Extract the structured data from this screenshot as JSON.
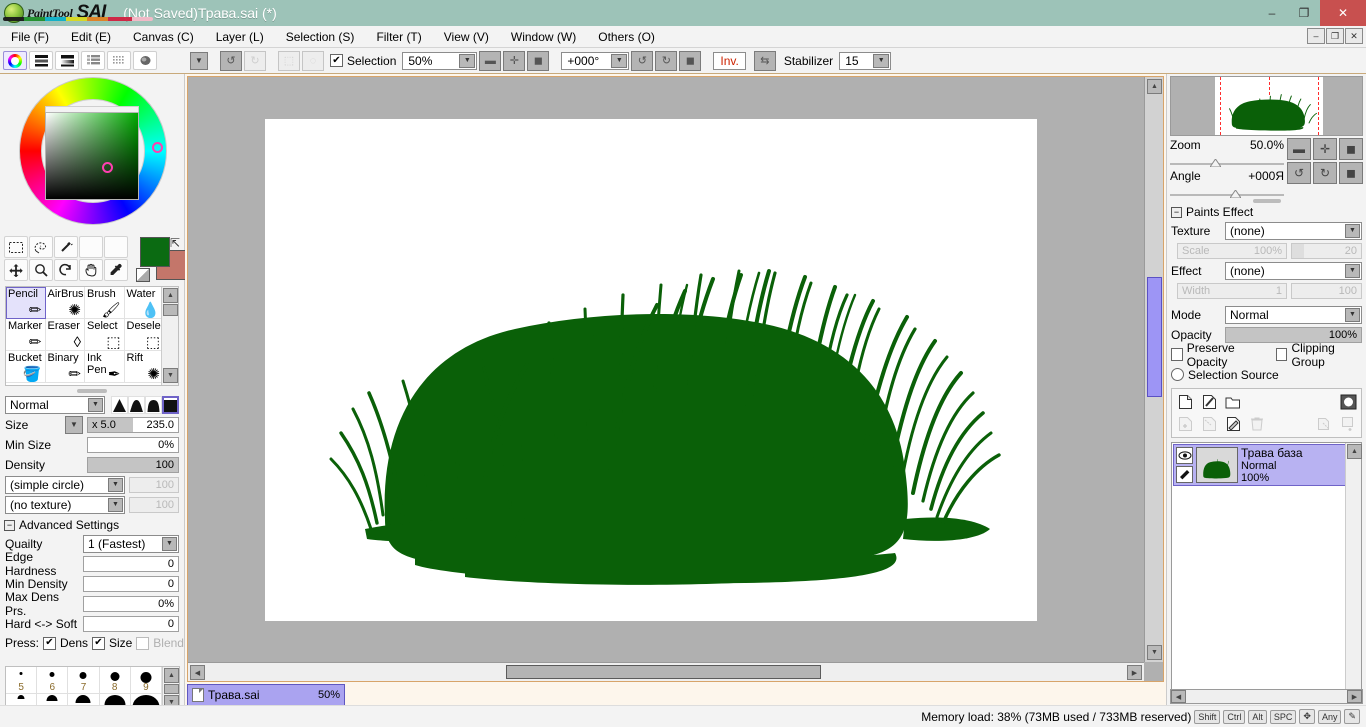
{
  "window": {
    "app_name_part1": "PaintTool",
    "app_name_part2": "SAI",
    "title": "(Not Saved)Трава.sai (*)",
    "minimize": "–",
    "restore": "❐",
    "close": "✕"
  },
  "mdi_controls": {
    "minimize": "–",
    "restore": "❐",
    "close": "✕"
  },
  "menubar": {
    "items": [
      {
        "label": "File (F)"
      },
      {
        "label": "Edit (E)"
      },
      {
        "label": "Canvas (C)"
      },
      {
        "label": "Layer (L)"
      },
      {
        "label": "Selection (S)"
      },
      {
        "label": "Filter (T)"
      },
      {
        "label": "View (V)"
      },
      {
        "label": "Window (W)"
      },
      {
        "label": "Others (O)"
      }
    ]
  },
  "toolbar": {
    "selection_label": "Selection",
    "selection_checked": true,
    "zoom_value": "50%",
    "angle_value": "+000°",
    "invert_label": "Inv.",
    "stabilizer_label": "Stabilizer",
    "stabilizer_value": "15",
    "icons": {
      "undo": "undo-icon",
      "redo": "redo-icon",
      "clear_selection": "clear-selection-icon",
      "invert_selection": "invert-selection-icon",
      "zoom_out": "zoom-out-icon",
      "zoom_in": "zoom-in-icon",
      "zoom_reset": "zoom-reset-icon",
      "rotate_left": "rotate-left-icon",
      "rotate_right": "rotate-right-icon",
      "rotate_reset": "rotate-reset-icon",
      "flip": "flip-horizontal-icon"
    }
  },
  "color_panel": {
    "modes": [
      "color-wheel-icon",
      "rgb-sliders-icon",
      "hsv-sliders-icon",
      "palette-icon",
      "swatches-icon",
      "scratch-icon"
    ],
    "selected_mode": 0,
    "primary_color": "#0b6b12",
    "secondary_color": "#c4766a"
  },
  "tools_top": {
    "row1": [
      "rect-select-icon",
      "lasso-icon",
      "magic-wand-icon",
      "blank-tool-1-icon",
      "blank-tool-2-icon"
    ],
    "row2": [
      "move-icon",
      "zoom-icon",
      "rotate-icon",
      "hand-icon",
      "eyedropper-icon"
    ]
  },
  "tool_list": {
    "selected": "Pencil",
    "items": [
      {
        "label": "Pencil",
        "icon": "pencil-icon"
      },
      {
        "label": "AirBrush",
        "icon": "airbrush-icon"
      },
      {
        "label": "Brush",
        "icon": "brush-icon"
      },
      {
        "label": "Water",
        "icon": "water-icon"
      },
      {
        "label": "Marker",
        "icon": "marker-icon"
      },
      {
        "label": "Eraser",
        "icon": "eraser-icon"
      },
      {
        "label": "Select",
        "icon": "select-pen-icon"
      },
      {
        "label": "Deselect",
        "icon": "deselect-icon"
      },
      {
        "label": "Bucket",
        "icon": "bucket-icon"
      },
      {
        "label": "Binary",
        "icon": "binary-pen-icon"
      },
      {
        "label": "Ink Pen",
        "icon": "ink-pen-icon"
      },
      {
        "label": "Rift",
        "icon": "rift-icon"
      }
    ]
  },
  "brush_settings": {
    "blend_mode": "Normal",
    "size_label": "Size",
    "size_multiplier": "x 5.0",
    "size_value": "235.0",
    "min_size_label": "Min Size",
    "min_size_value": "0%",
    "density_label": "Density",
    "density_value": "100",
    "shape_label": "(simple circle)",
    "shape_value": "100",
    "texture_label": "(no texture)",
    "texture_value": "100",
    "edge_shapes": [
      "soft-cone-icon",
      "medium-cone-icon",
      "hard-cone-icon",
      "flat-square-icon"
    ],
    "edge_shape_selected": 3
  },
  "advanced_settings": {
    "header": "Advanced Settings",
    "quality_label": "Quailty",
    "quality_value": "1 (Fastest)",
    "rows": [
      {
        "label": "Edge Hardness",
        "value": "0"
      },
      {
        "label": "Min Density",
        "value": "0"
      },
      {
        "label": "Max Dens Prs.",
        "value": "0%"
      },
      {
        "label": "Hard <-> Soft",
        "value": "0"
      }
    ],
    "press_label": "Press:",
    "press_dens_label": "Dens",
    "press_dens_checked": true,
    "press_size_label": "Size",
    "press_size_checked": true,
    "press_blend_label": "Blend",
    "press_blend_checked": false
  },
  "brush_presets": {
    "row1": [
      "5",
      "6",
      "7",
      "8",
      "9"
    ],
    "dot_sizes": [
      3,
      5,
      7,
      9,
      11
    ]
  },
  "canvas": {
    "artwork_color": "#0a6008",
    "paper_color": "#ffffff",
    "tab_label": "Трава.sai",
    "tab_zoom": "50%"
  },
  "navigator": {
    "zoom_label": "Zoom",
    "zoom_value": "50.0%",
    "angle_label": "Angle",
    "angle_value": "+000Я",
    "buttons": [
      "zoom-out-icon",
      "zoom-in-icon",
      "zoom-reset-icon",
      "rotate-left-icon",
      "rotate-right-icon",
      "rotate-reset-icon"
    ]
  },
  "paints_effect": {
    "header": "Paints Effect",
    "texture_label": "Texture",
    "texture_value": "(none)",
    "scale_label": "Scale",
    "scale_value": "100%",
    "scale_value2": "20",
    "effect_label": "Effect",
    "effect_value": "(none)",
    "width_label": "Width",
    "width_value": "1",
    "width_value2": "100"
  },
  "layer_panel": {
    "mode_label": "Mode",
    "mode_value": "Normal",
    "opacity_label": "Opacity",
    "opacity_value": "100%",
    "preserve_opacity_label": "Preserve Opacity",
    "preserve_opacity_checked": false,
    "clipping_group_label": "Clipping Group",
    "clipping_group_checked": false,
    "selection_source_label": "Selection Source",
    "selection_source_checked": false,
    "buttons_row1": [
      "new-layer-icon",
      "new-linework-layer-icon",
      "new-folder-icon",
      "layer-mask-icon"
    ],
    "buttons_row2": [
      "duplicate-layer-icon",
      "merge-down-icon",
      "clear-layer-icon",
      "delete-layer-icon",
      "merge-icon",
      "add-below-icon"
    ],
    "layers": [
      {
        "name": "Трава база",
        "mode": "Normal",
        "opacity": "100%",
        "visible": true,
        "selected": true,
        "visibility_icon": "eye-icon",
        "edit_icon": "pen-icon"
      }
    ]
  },
  "statusbar": {
    "memory_text": "Memory load: 38% (73MB used / 733MB reserved)",
    "keys": [
      "Shift",
      "Ctrl",
      "Alt",
      "SPC"
    ],
    "nav_key": "move-key-icon",
    "any_key": "Any",
    "pen_icon": "pen-icon"
  }
}
